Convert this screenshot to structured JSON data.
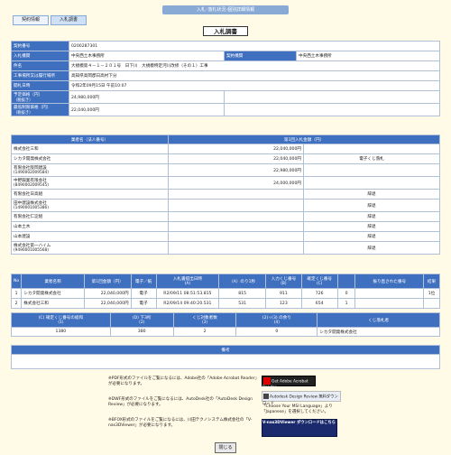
{
  "topbar": "入札･落札状況-個別詳細情報",
  "tabs": [
    "契約情報",
    "入札調書"
  ],
  "title": "入札調書",
  "info": {
    "contract_no_label": "契約番号",
    "contract_no": "0200287301",
    "org_label": "入札機関",
    "org": "中央西土木事務所",
    "contract_org_label": "契約機関",
    "contract_org": "中央西土木事務所",
    "project_label": "件名",
    "project": "大規模第４－１－２０１号　日下川　大規模特定河川改修（その１）工事",
    "place_label": "工事場所又は履行場所",
    "place": "高知県高岡郡日高村下分",
    "open_label": "開札日時",
    "open": "令和2年09月15日 午前10:07",
    "estimate_label": "予定価格（円）",
    "estimate_sub": "（税抜き）",
    "estimate": "24,980,000円",
    "min_label": "最低制限価格（円）",
    "min_sub": "（税抜き）",
    "min": "22,040,000円"
  },
  "bids_header": {
    "name": "業者名（法人番号）",
    "amount": "第1回入札金額（円）"
  },
  "bids": [
    {
      "name": "株式会社三和",
      "sub": "",
      "amount": "22,040,000円",
      "note": ""
    },
    {
      "name": "シカタ開発株式会社",
      "sub": "",
      "amount": "22,040,000円",
      "note": "電子くじ落札"
    },
    {
      "name": "有限会社阪岡建設",
      "sub": "(1490002009584)",
      "amount": "22,980,000円",
      "note": ""
    },
    {
      "name": "中野興業有限会社",
      "sub": "(8490002009545)",
      "amount": "24,000,000円",
      "note": ""
    },
    {
      "name": "有限会社日高組",
      "sub": "",
      "amount": "",
      "note": "辞退"
    },
    {
      "name": "田中建設株式会社",
      "sub": "(1490001005386)",
      "amount": "",
      "note": "辞退"
    },
    {
      "name": "有限会社仁淀組",
      "sub": "",
      "amount": "",
      "note": "辞退"
    },
    {
      "name": "山本土木",
      "sub": "",
      "amount": "",
      "note": "辞退"
    },
    {
      "name": "山本建設",
      "sub": "",
      "amount": "",
      "note": "辞退"
    },
    {
      "name": "株式会社第一ハイム",
      "sub": "(9490001005568)",
      "amount": "",
      "note": "辞退"
    }
  ],
  "lottery_header": [
    "No",
    "業者名称",
    "第1回金額（円）",
    "電子／紙",
    "入札書提出日時",
    "（A）のり1秒",
    "入力くじ番号",
    "確定くじ番号",
    "",
    "振り直された番号",
    "結果"
  ],
  "lottery_header_sub": [
    "",
    "",
    "",
    "",
    "(A)",
    "",
    "(B)",
    "(C)",
    "",
    "",
    ""
  ],
  "lottery_rows": [
    [
      "1",
      "シカタ開発株式会社",
      "22,040,000円",
      "電子",
      "R2/09/11 08:51:53.815",
      "815",
      "911",
      "726",
      "0",
      "",
      "1位"
    ],
    [
      "2",
      "株式会社三和",
      "22,040,000円",
      "電子",
      "R2/09/14 09:40:20.531",
      "531",
      "123",
      "654",
      "1",
      "",
      ""
    ]
  ],
  "summary_header": [
    "(C) 確定くじ番号の総和",
    "(1)",
    "(D) 下3桁",
    "(2)",
    "くじ対象者数",
    "(3)",
    "(2)÷(3) の余り",
    "(4)",
    "くじ落札者"
  ],
  "summary_values": [
    "1380",
    "380",
    "2",
    "0",
    "シカタ開発株式会社"
  ],
  "remarks_label": "備考",
  "notes": {
    "pdf": "※PDF形式のファイルをご覧になるには、Adobe社の「Adobe Acrobat Reader」が必要になります。",
    "dwf": "※DWF形式のファイルをご覧になるには、AutoDesk社の「AutoDesk Design Review」が必要になります。",
    "bfox": "※BFOX形式のファイルをご覧になるには、川田テクノシステム株式会社の「V-nas3DViewer」が必要になります。",
    "msi1": "「Choose Your MSI Language」より",
    "msi2": "「Japanese」を選択してください。"
  },
  "badges": {
    "adobe": "Get Adobe Acrobat Reader",
    "autodesk": "Autodesk Design Review 無料ダウンロード",
    "vnas": "V-nas3DViewer ダウンロードはこちら"
  },
  "close": "閉じる"
}
